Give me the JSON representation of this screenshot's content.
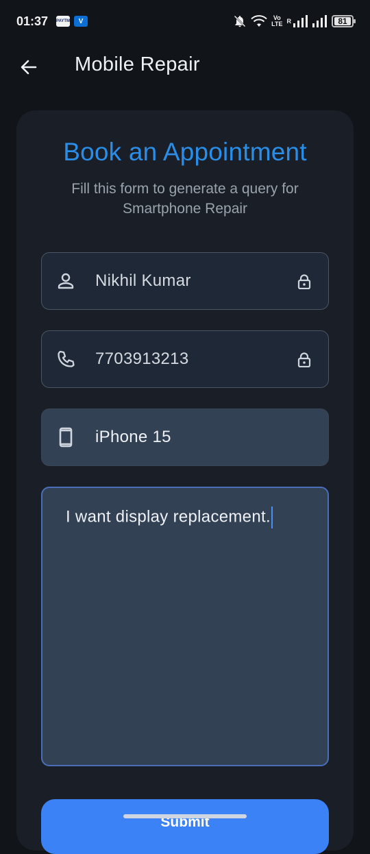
{
  "status_bar": {
    "time": "01:37",
    "app_icons": [
      "paytm-icon",
      "app-v-icon"
    ],
    "paytm_label": "PAYTM",
    "v_label": "V",
    "volte_label": "Vo\nLTE",
    "roaming": "R",
    "battery": "81"
  },
  "app_bar": {
    "title": "Mobile Repair",
    "back_icon": "arrow-left-icon"
  },
  "form": {
    "title": "Book an Appointment",
    "subtitle": "Fill this form to generate a query for Smartphone Repair",
    "name_value": "Nikhil Kumar",
    "phone_value": "7703913213",
    "device_value": "iPhone 15",
    "message_value": "I want display replacement.",
    "submit_label": "Submit"
  },
  "colors": {
    "accent": "#2a8ee8",
    "button": "#3b82f6",
    "background": "#111419",
    "card": "#1a1f27"
  }
}
